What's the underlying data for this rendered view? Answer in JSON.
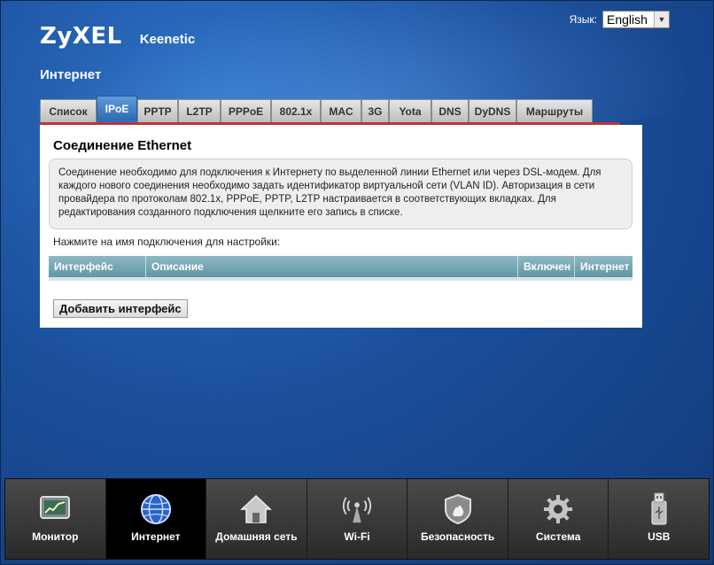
{
  "header": {
    "brand": "ZyXEL",
    "product": "Keenetic",
    "language_label": "Язык:",
    "language_selected": "English",
    "page_title": "Интернет"
  },
  "tabs": [
    {
      "label": "Список",
      "active": false
    },
    {
      "label": "IPoE",
      "active": true
    },
    {
      "label": "PPTP",
      "active": false
    },
    {
      "label": "L2TP",
      "active": false
    },
    {
      "label": "PPPoE",
      "active": false
    },
    {
      "label": "802.1x",
      "active": false
    },
    {
      "label": "MAC",
      "active": false
    },
    {
      "label": "3G",
      "active": false
    },
    {
      "label": "Yota",
      "active": false
    },
    {
      "label": "DNS",
      "active": false
    },
    {
      "label": "DyDNS",
      "active": false
    },
    {
      "label": "Маршруты",
      "active": false
    }
  ],
  "panel": {
    "title": "Соединение Ethernet",
    "info": "Соединение необходимо для подключения к Интернету по выделенной линии Ethernet или через DSL-модем. Для каждого нового соединения необходимо задать идентификатор виртуальной сети (VLAN ID). Авторизация в сети провайдера по протоколам 802.1x, PPPoE, PPTP, L2TP настраивается в соответствующих вкладках. Для редактирования созданного подключения щелкните его запись в списке.",
    "hint": "Нажмите на имя подключения для настройки:",
    "columns": [
      "Интерфейс",
      "Описание",
      "Включен",
      "Интернет"
    ],
    "add_button": "Добавить интерфейс"
  },
  "nav": [
    {
      "label": "Монитор",
      "icon": "monitor-icon",
      "active": false
    },
    {
      "label": "Интернет",
      "icon": "globe-icon",
      "active": true
    },
    {
      "label": "Домашняя сеть",
      "icon": "home-icon",
      "active": false
    },
    {
      "label": "Wi-Fi",
      "icon": "wifi-antenna-icon",
      "active": false
    },
    {
      "label": "Безопасность",
      "icon": "shield-icon",
      "active": false
    },
    {
      "label": "Система",
      "icon": "gear-icon",
      "active": false
    },
    {
      "label": "USB",
      "icon": "usb-icon",
      "active": false
    }
  ],
  "colors": {
    "tab_active": "#2e6bb2",
    "accent_red": "#c0323c",
    "table_header": "#5f97a6"
  }
}
